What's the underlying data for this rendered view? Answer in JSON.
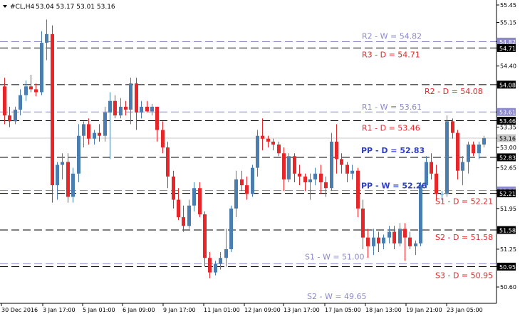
{
  "header": {
    "symbol_label": "#CL,H4",
    "ohlc_text": "53.04 53.17 53.01 53.16",
    "menu_icon": "triangle-down-icon"
  },
  "colors": {
    "bull": "#4a7eb0",
    "bear": "#e8262a",
    "daily_line": "#000000",
    "weekly_line": "#8c88cc",
    "resistance_text": "#e8262a",
    "weekly_text": "#8c88cc",
    "pivot_text": "#3040c8"
  },
  "chart_data": {
    "type": "candlestick",
    "symbol": "#CL",
    "timeframe": "H4",
    "ylim": [
      50.38,
      55.45
    ],
    "y_ticks": [
      "55.45",
      "55.15",
      "54.82",
      "54.71",
      "54.40",
      "54.08",
      "53.61",
      "53.46",
      "53.35",
      "53.16",
      "53.00",
      "52.83",
      "52.65",
      "52.26",
      "52.21",
      "51.95",
      "51.58",
      "51.25",
      "50.95",
      "50.60"
    ],
    "highlight_labels": {
      "54.82": "weekly",
      "54.71": "daily",
      "54.08": "daily",
      "53.61": "weekly",
      "53.46": "daily",
      "53.16": "current",
      "52.83": "daily",
      "52.26": "weekly",
      "52.21": "daily",
      "51.58": "daily",
      "50.95": "daily"
    },
    "x_labels": [
      "30 Dec 2016",
      "3 Jan 17:00",
      "5 Jan 01:00",
      "6 Jan 09:00",
      "9 Jan 17:00",
      "11 Jan 01:00",
      "12 Jan 09:00",
      "13 Jan 17:00",
      "17 Jan 05:00",
      "18 Jan 13:00",
      "19 Jan 21:00",
      "23 Jan 05:00"
    ],
    "current_price": 53.16,
    "levels": [
      {
        "label": "R2 - W = 54.82",
        "value": 54.82,
        "kind": "weekly"
      },
      {
        "label": "R3 - D = 54.71",
        "value": 54.71,
        "kind": "daily"
      },
      {
        "label": "R2 - D = 54.08",
        "value": 54.08,
        "kind": "daily"
      },
      {
        "label": "R1 - W = 53.61",
        "value": 53.61,
        "kind": "weekly"
      },
      {
        "label": "R1 - D = 53.46",
        "value": 53.46,
        "kind": "daily"
      },
      {
        "label": "PP - D = 52.83",
        "value": 52.83,
        "kind": "daily"
      },
      {
        "label": "PP - W = 52.26",
        "value": 52.26,
        "kind": "weekly"
      },
      {
        "label": "S1 - D = 52.21",
        "value": 52.21,
        "kind": "daily"
      },
      {
        "label": "S2 - D = 51.58",
        "value": 51.58,
        "kind": "daily"
      },
      {
        "label": "S1 - W = 51.00",
        "value": 51.0,
        "kind": "weekly"
      },
      {
        "label": "S3 - D = 50.95",
        "value": 50.95,
        "kind": "daily"
      },
      {
        "label": "S2 - W = 49.65",
        "value": 49.65,
        "kind": "weekly"
      }
    ],
    "candles": [
      [
        54.05,
        54.2,
        53.4,
        53.55
      ],
      [
        53.55,
        53.7,
        53.35,
        53.45
      ],
      [
        53.45,
        53.7,
        53.4,
        53.65
      ],
      [
        53.65,
        54.0,
        53.55,
        53.9
      ],
      [
        53.9,
        54.15,
        53.8,
        54.05
      ],
      [
        54.05,
        54.25,
        53.95,
        54.0
      ],
      [
        54.0,
        54.1,
        53.88,
        53.95
      ],
      [
        53.95,
        55.0,
        53.9,
        54.8
      ],
      [
        54.8,
        55.2,
        54.5,
        54.95
      ],
      [
        54.95,
        55.1,
        52.05,
        52.35
      ],
      [
        52.35,
        52.75,
        52.1,
        52.7
      ],
      [
        52.7,
        52.9,
        52.45,
        52.75
      ],
      [
        52.75,
        52.9,
        52.05,
        52.15
      ],
      [
        52.15,
        52.65,
        52.05,
        52.55
      ],
      [
        52.55,
        53.4,
        52.4,
        53.2
      ],
      [
        53.2,
        53.45,
        53.0,
        53.4
      ],
      [
        53.4,
        53.5,
        53.05,
        53.15
      ],
      [
        53.15,
        53.3,
        53.05,
        53.25
      ],
      [
        53.25,
        53.4,
        53.1,
        53.2
      ],
      [
        53.2,
        53.7,
        53.1,
        53.6
      ],
      [
        53.6,
        53.95,
        52.8,
        53.8
      ],
      [
        53.8,
        53.9,
        53.5,
        53.55
      ],
      [
        53.55,
        53.85,
        53.5,
        53.7
      ],
      [
        53.7,
        53.8,
        53.55,
        53.65
      ],
      [
        53.65,
        54.2,
        53.4,
        54.1
      ],
      [
        54.1,
        54.2,
        53.3,
        53.6
      ],
      [
        53.6,
        53.8,
        53.5,
        53.7
      ],
      [
        53.7,
        53.8,
        53.6,
        53.62
      ],
      [
        53.62,
        53.75,
        53.55,
        53.7
      ],
      [
        53.7,
        53.7,
        53.1,
        53.3
      ],
      [
        53.3,
        53.45,
        52.9,
        53.0
      ],
      [
        53.0,
        53.1,
        52.3,
        52.5
      ],
      [
        52.5,
        52.6,
        51.95,
        52.1
      ],
      [
        52.1,
        52.3,
        51.75,
        51.8
      ],
      [
        51.8,
        52.0,
        51.55,
        51.65
      ],
      [
        51.65,
        52.1,
        51.6,
        52.0
      ],
      [
        52.0,
        52.4,
        51.9,
        52.3
      ],
      [
        52.3,
        52.4,
        51.8,
        51.85
      ],
      [
        51.85,
        51.9,
        50.95,
        51.1
      ],
      [
        51.1,
        51.2,
        50.75,
        50.85
      ],
      [
        50.85,
        51.05,
        50.8,
        51.0
      ],
      [
        51.0,
        51.2,
        50.9,
        51.1
      ],
      [
        51.1,
        51.6,
        50.95,
        51.25
      ],
      [
        51.25,
        52.0,
        51.2,
        51.95
      ],
      [
        51.95,
        52.6,
        51.8,
        52.45
      ],
      [
        52.45,
        52.6,
        52.25,
        52.35
      ],
      [
        52.35,
        52.5,
        52.1,
        52.2
      ],
      [
        52.2,
        52.7,
        52.15,
        52.65
      ],
      [
        52.65,
        53.3,
        52.5,
        53.2
      ],
      [
        53.2,
        53.5,
        52.95,
        53.15
      ],
      [
        53.15,
        53.2,
        53.0,
        53.1
      ],
      [
        53.1,
        53.15,
        52.95,
        53.05
      ],
      [
        53.05,
        53.1,
        52.85,
        52.9
      ],
      [
        52.9,
        53.0,
        52.25,
        52.45
      ],
      [
        52.45,
        52.9,
        52.4,
        52.85
      ],
      [
        52.85,
        52.9,
        52.4,
        52.55
      ],
      [
        52.55,
        52.7,
        52.35,
        52.5
      ],
      [
        52.5,
        52.55,
        52.25,
        52.4
      ],
      [
        52.4,
        52.55,
        52.1,
        52.45
      ],
      [
        52.45,
        52.65,
        52.35,
        52.55
      ],
      [
        52.55,
        52.7,
        52.2,
        52.4
      ],
      [
        52.4,
        52.5,
        52.15,
        52.3
      ],
      [
        52.3,
        53.25,
        52.25,
        53.1
      ],
      [
        53.1,
        53.4,
        52.55,
        52.8
      ],
      [
        52.8,
        52.9,
        52.55,
        52.7
      ],
      [
        52.7,
        52.75,
        52.4,
        52.55
      ],
      [
        52.55,
        52.7,
        52.45,
        52.6
      ],
      [
        52.6,
        52.65,
        51.8,
        51.95
      ],
      [
        51.95,
        52.1,
        51.25,
        51.45
      ],
      [
        51.45,
        51.6,
        51.1,
        51.3
      ],
      [
        51.3,
        51.6,
        51.15,
        51.45
      ],
      [
        51.45,
        51.55,
        51.2,
        51.35
      ],
      [
        51.35,
        51.5,
        51.25,
        51.45
      ],
      [
        51.45,
        51.65,
        51.35,
        51.55
      ],
      [
        51.55,
        51.65,
        51.25,
        51.35
      ],
      [
        51.35,
        51.7,
        51.3,
        51.6
      ],
      [
        51.6,
        51.7,
        51.05,
        51.45
      ],
      [
        51.45,
        51.55,
        51.25,
        51.3
      ],
      [
        51.3,
        51.4,
        51.15,
        51.35
      ],
      [
        51.35,
        52.4,
        51.3,
        52.35
      ],
      [
        52.35,
        52.85,
        52.3,
        52.75
      ],
      [
        52.75,
        52.9,
        52.45,
        52.55
      ],
      [
        52.55,
        52.7,
        52.1,
        52.2
      ],
      [
        52.2,
        52.25,
        52.1,
        52.2
      ],
      [
        52.2,
        53.55,
        52.15,
        53.45
      ],
      [
        53.45,
        53.5,
        53.15,
        53.25
      ],
      [
        53.25,
        53.3,
        52.45,
        52.6
      ],
      [
        52.6,
        52.85,
        52.35,
        52.75
      ],
      [
        52.75,
        53.1,
        52.55,
        53.05
      ],
      [
        53.05,
        53.1,
        52.85,
        52.9
      ],
      [
        52.9,
        53.1,
        52.8,
        53.05
      ],
      [
        53.05,
        53.2,
        53.0,
        53.16
      ]
    ]
  }
}
